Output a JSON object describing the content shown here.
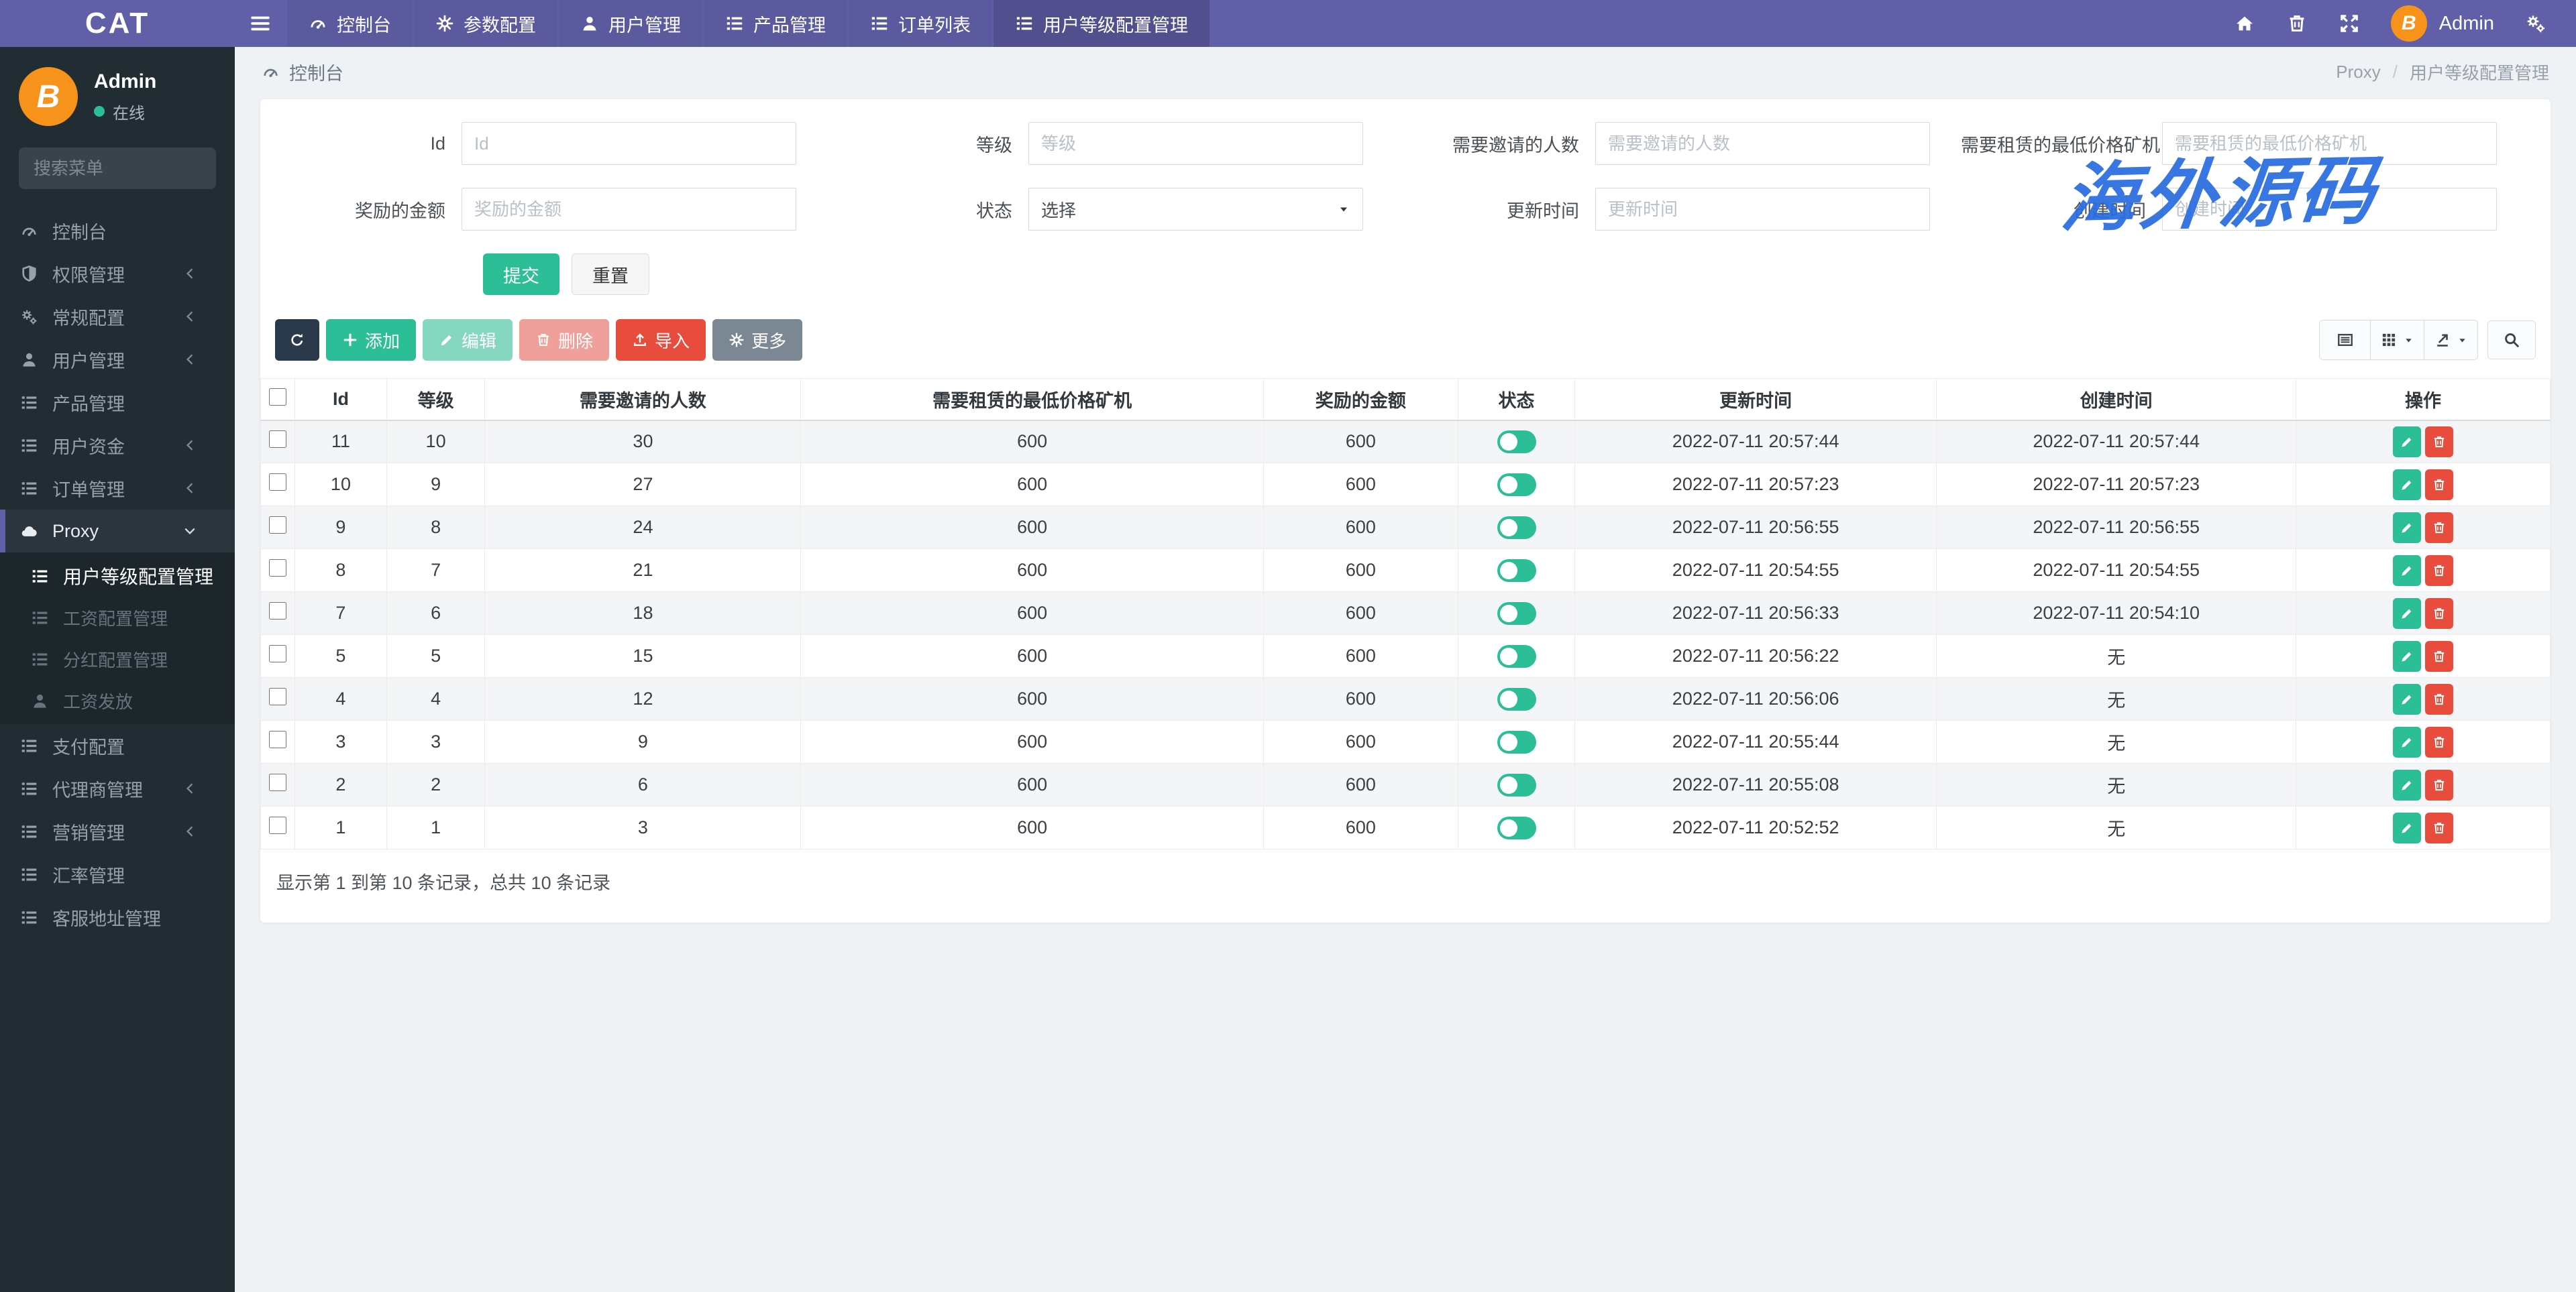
{
  "colors": {
    "navbar_purple": "#615fa8",
    "sidebar_dark": "#222d33",
    "content_bg": "#eff2f5",
    "teal": "#2cbe97",
    "red": "#e74c3c",
    "watermark_blue": "#2a6ce0"
  },
  "navbar": {
    "brand": "CAT",
    "items": [
      {
        "label": "控制台",
        "icon": "gauge-icon",
        "active": false
      },
      {
        "label": "参数配置",
        "icon": "gear-icon",
        "active": false
      },
      {
        "label": "用户管理",
        "icon": "user-icon",
        "active": false
      },
      {
        "label": "产品管理",
        "icon": "list-icon",
        "active": false
      },
      {
        "label": "订单列表",
        "icon": "list-icon",
        "active": false
      },
      {
        "label": "用户等级配置管理",
        "icon": "list-icon",
        "active": true
      }
    ],
    "user_name": "Admin",
    "avatar_letter": "B"
  },
  "sidebar": {
    "user": {
      "name": "Admin",
      "status": "在线",
      "avatar_letter": "B"
    },
    "search_placeholder": "搜索菜单",
    "items": [
      {
        "label": "控制台",
        "icon": "gauge-icon",
        "expandable": false
      },
      {
        "label": "权限管理",
        "icon": "shield-icon",
        "expandable": true
      },
      {
        "label": "常规配置",
        "icon": "gears-icon",
        "expandable": true
      },
      {
        "label": "用户管理",
        "icon": "user-icon",
        "expandable": true
      },
      {
        "label": "产品管理",
        "icon": "list-icon",
        "expandable": false
      },
      {
        "label": "用户资金",
        "icon": "list-icon",
        "expandable": true
      },
      {
        "label": "订单管理",
        "icon": "list-icon",
        "expandable": true
      },
      {
        "label": "Proxy",
        "icon": "cloud-icon",
        "expandable": true,
        "expanded": true,
        "active": true,
        "children": [
          {
            "label": "用户等级配置管理",
            "icon": "list-icon",
            "active": true
          },
          {
            "label": "工资配置管理",
            "icon": "list-icon",
            "active": false
          },
          {
            "label": "分红配置管理",
            "icon": "list-icon",
            "active": false
          },
          {
            "label": "工资发放",
            "icon": "user-icon",
            "active": false
          }
        ]
      },
      {
        "label": "支付配置",
        "icon": "list-icon",
        "expandable": false
      },
      {
        "label": "代理商管理",
        "icon": "list-icon",
        "expandable": true
      },
      {
        "label": "营销管理",
        "icon": "list-icon",
        "expandable": true
      },
      {
        "label": "汇率管理",
        "icon": "list-icon",
        "expandable": false
      },
      {
        "label": "客服地址管理",
        "icon": "list-icon",
        "expandable": false
      }
    ]
  },
  "breadcrumb": {
    "left": "控制台",
    "section": "Proxy",
    "separator": "/",
    "page": "用户等级配置管理"
  },
  "filter_form": {
    "fields": [
      {
        "label": "Id",
        "placeholder": "Id",
        "type": "input"
      },
      {
        "label": "等级",
        "placeholder": "等级",
        "type": "input"
      },
      {
        "label": "需要邀请的人数",
        "placeholder": "需要邀请的人数",
        "type": "input"
      },
      {
        "label": "需要租赁的最低价格矿机",
        "placeholder": "需要租赁的最低价格矿机",
        "type": "input"
      },
      {
        "label": "奖励的金额",
        "placeholder": "奖励的金额",
        "type": "input"
      },
      {
        "label": "状态",
        "placeholder": "选择",
        "type": "select"
      },
      {
        "label": "更新时间",
        "placeholder": "更新时间",
        "type": "input"
      },
      {
        "label": "创建时间",
        "placeholder": "创建时间",
        "type": "input"
      }
    ],
    "submit_label": "提交",
    "reset_label": "重置"
  },
  "toolbar": {
    "add_label": "添加",
    "edit_label": "编辑",
    "delete_label": "删除",
    "import_label": "导入",
    "more_label": "更多"
  },
  "table": {
    "headers": [
      "Id",
      "等级",
      "需要邀请的人数",
      "需要租赁的最低价格矿机",
      "奖励的金额",
      "状态",
      "更新时间",
      "创建时间",
      "操作"
    ],
    "col_widths": [
      1.5,
      4,
      4.3,
      13.8,
      20.2,
      8.5,
      5.1,
      15.8,
      15.7,
      11.1
    ],
    "rows": [
      {
        "id": "11",
        "level": "10",
        "invites": "30",
        "min_rent": "600",
        "reward": "600",
        "status_on": true,
        "updated": "2022-07-11 20:57:44",
        "created": "2022-07-11 20:57:44"
      },
      {
        "id": "10",
        "level": "9",
        "invites": "27",
        "min_rent": "600",
        "reward": "600",
        "status_on": true,
        "updated": "2022-07-11 20:57:23",
        "created": "2022-07-11 20:57:23"
      },
      {
        "id": "9",
        "level": "8",
        "invites": "24",
        "min_rent": "600",
        "reward": "600",
        "status_on": true,
        "updated": "2022-07-11 20:56:55",
        "created": "2022-07-11 20:56:55"
      },
      {
        "id": "8",
        "level": "7",
        "invites": "21",
        "min_rent": "600",
        "reward": "600",
        "status_on": true,
        "updated": "2022-07-11 20:54:55",
        "created": "2022-07-11 20:54:55"
      },
      {
        "id": "7",
        "level": "6",
        "invites": "18",
        "min_rent": "600",
        "reward": "600",
        "status_on": true,
        "updated": "2022-07-11 20:56:33",
        "created": "2022-07-11 20:54:10"
      },
      {
        "id": "5",
        "level": "5",
        "invites": "15",
        "min_rent": "600",
        "reward": "600",
        "status_on": true,
        "updated": "2022-07-11 20:56:22",
        "created": "无"
      },
      {
        "id": "4",
        "level": "4",
        "invites": "12",
        "min_rent": "600",
        "reward": "600",
        "status_on": true,
        "updated": "2022-07-11 20:56:06",
        "created": "无"
      },
      {
        "id": "3",
        "level": "3",
        "invites": "9",
        "min_rent": "600",
        "reward": "600",
        "status_on": true,
        "updated": "2022-07-11 20:55:44",
        "created": "无"
      },
      {
        "id": "2",
        "level": "2",
        "invites": "6",
        "min_rent": "600",
        "reward": "600",
        "status_on": true,
        "updated": "2022-07-11 20:55:08",
        "created": "无"
      },
      {
        "id": "1",
        "level": "1",
        "invites": "3",
        "min_rent": "600",
        "reward": "600",
        "status_on": true,
        "updated": "2022-07-11 20:52:52",
        "created": "无"
      }
    ]
  },
  "summary": "显示第 1 到第 10 条记录，总共 10 条记录",
  "watermark": "海外源码"
}
